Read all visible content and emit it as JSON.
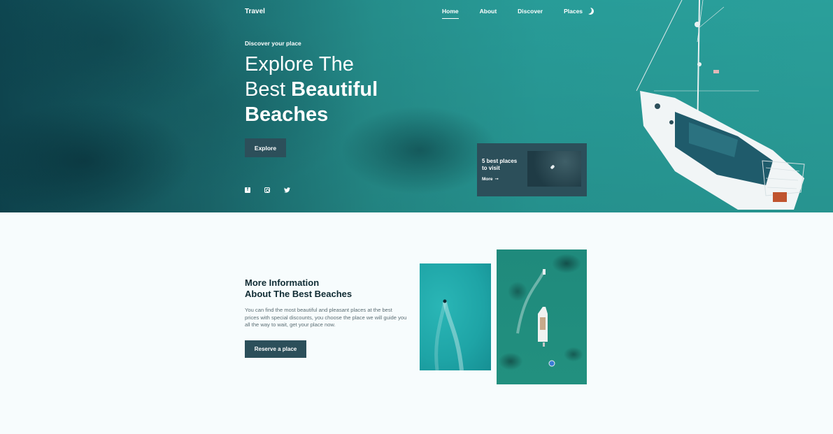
{
  "nav": {
    "logo": "Travel",
    "links": [
      "Home",
      "About",
      "Discover",
      "Places"
    ],
    "active": "Home",
    "theme_icon": "moon-icon"
  },
  "hero": {
    "subtitle": "Discover your place",
    "title_line1": "Explore The",
    "title_line2_regular": "Best ",
    "title_line2_bold": "Beautiful",
    "title_line3": "Beaches",
    "explore_label": "Explore",
    "socials": [
      "facebook-icon",
      "instagram-icon",
      "twitter-icon"
    ]
  },
  "promo": {
    "text": "5 best places to visit",
    "more_label": "More",
    "arrow_icon": "arrow-right-icon"
  },
  "info": {
    "title_line1": "More Information",
    "title_line2": "About The Best Beaches",
    "description": "You can find the most beautiful and pleasant places at the best prices with special discounts, you choose the place we will guide you all the way to wait, get your place now.",
    "reserve_label": "Reserve a place"
  },
  "colors": {
    "accent": "#2c4f5a",
    "sea": "#2aa4a0",
    "background": "#f7fcfd"
  }
}
